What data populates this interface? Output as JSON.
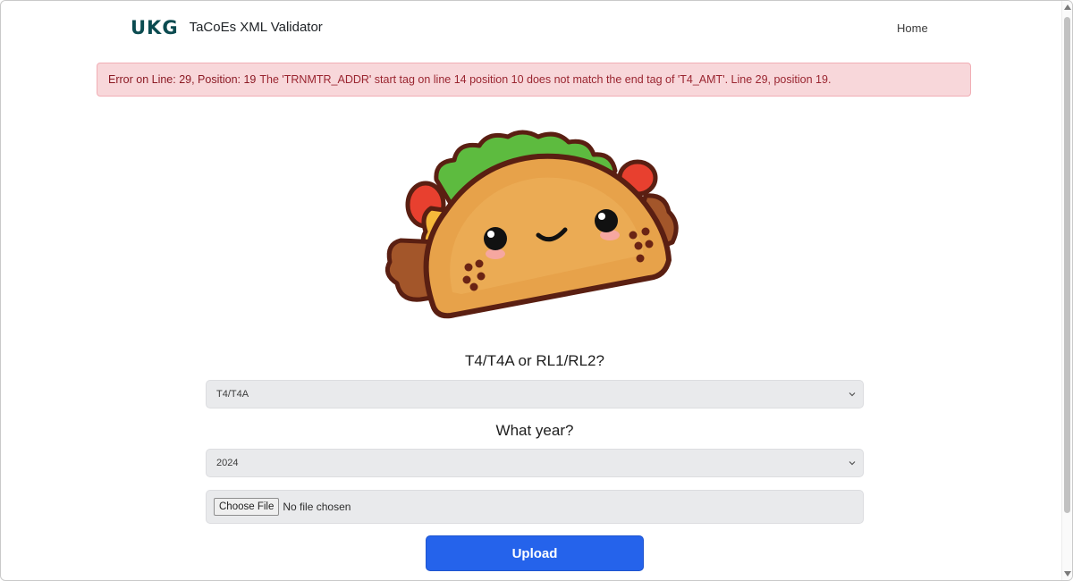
{
  "brand": {
    "logo": "UKG",
    "title": "TaCoEs XML Validator"
  },
  "nav": {
    "home": "Home"
  },
  "alert": {
    "heading": "Error on Line: 29, Position: 19",
    "message": "The 'TRNMTR_ADDR' start tag on line 14 position 10 does not match the end tag of 'T4_AMT'. Line 29, position 19."
  },
  "form": {
    "form_type_label": "T4/T4A or RL1/RL2?",
    "form_type_value": "T4/T4A",
    "year_label": "What year?",
    "year_value": "2024",
    "file_button": "Choose File",
    "file_status": "No file chosen",
    "upload_label": "Upload"
  },
  "colors": {
    "accent": "#2563eb",
    "brand": "#0b4b50",
    "alert_bg": "#f8d7da",
    "alert_text": "#9a2530"
  }
}
